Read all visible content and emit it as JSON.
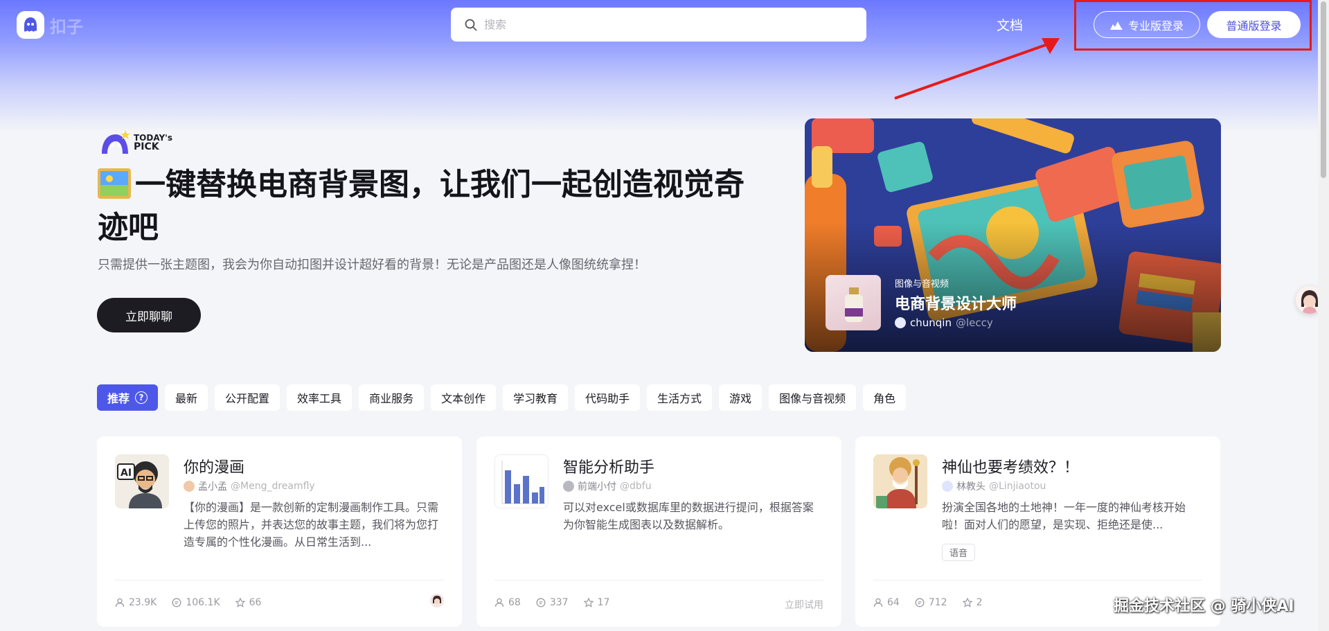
{
  "header": {
    "logo_text": "扣子",
    "search_placeholder": "搜索",
    "docs_label": "文档",
    "pro_login_label": "专业版登录",
    "normal_login_label": "普通版登录"
  },
  "hero": {
    "badge_line1": "TODAY's",
    "badge_line2": "PICK",
    "title": "一键替换电商背景图，让我们一起创造视觉奇迹吧",
    "description": "只需提供一张主题图，我会为你自动扣图并设计超好看的背景！无论是产品图还是人像图统统拿捏！",
    "cta_label": "立即聊聊",
    "card": {
      "category": "图像与音视频",
      "name": "电商背景设计大师",
      "author": "chunqin",
      "handle": "@leccy"
    }
  },
  "tabs": [
    {
      "label": "推荐",
      "active": true
    },
    {
      "label": "最新"
    },
    {
      "label": "公开配置"
    },
    {
      "label": "效率工具"
    },
    {
      "label": "商业服务"
    },
    {
      "label": "文本创作"
    },
    {
      "label": "学习教育"
    },
    {
      "label": "代码助手"
    },
    {
      "label": "生活方式"
    },
    {
      "label": "游戏"
    },
    {
      "label": "图像与音视频"
    },
    {
      "label": "角色"
    }
  ],
  "help_glyph": "?",
  "cards": [
    {
      "title": "你的漫画",
      "author": "孟小孟",
      "handle": "@Meng_dreamfly",
      "description": "【你的漫画】是一款创新的定制漫画制作工具。只需上传您的照片，并表达您的故事主题，我们将为您打造专属的个性化漫画。从日常生活到...",
      "users": "23.9K",
      "comments": "106.1K",
      "favorites": "66"
    },
    {
      "title": "智能分析助手",
      "author": "前端小付",
      "handle": "@dbfu",
      "description": "可以对excel或数据库里的数据进行提问，根据答案为你智能生成图表以及数据解析。",
      "users": "68",
      "comments": "337",
      "favorites": "17",
      "action": "立即试用"
    },
    {
      "title": "神仙也要考绩效？！",
      "author": "林教头",
      "handle": "@Linjiaotou",
      "description": "扮演全国各地的土地神！一年一度的神仙考核开始啦！面对人们的愿望，是实现、拒绝还是使...",
      "tag": "语音",
      "users": "64",
      "comments": "712",
      "favorites": "2"
    }
  ],
  "watermark": "掘金技术社区 @ 骑小侠AI",
  "colors": {
    "accent": "#4e58e8",
    "highlight_box": "#e61a1a",
    "dark_button": "#1c1c22"
  },
  "icons": {
    "search": "magnifier",
    "pro_login": "chart-mountain-icon",
    "help": "question-circle-icon",
    "users": "user-icon",
    "comments": "comment-icon",
    "favorites": "star-icon"
  }
}
